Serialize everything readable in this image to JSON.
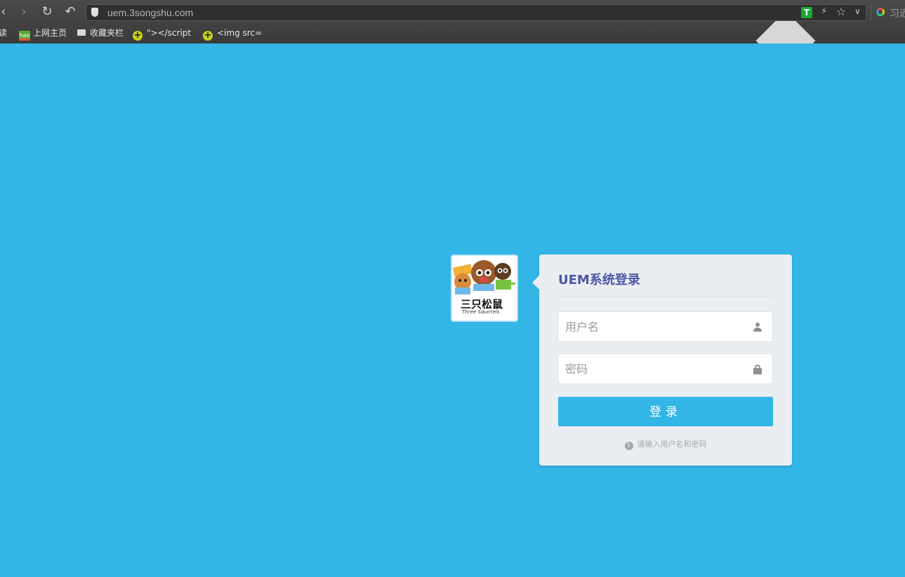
{
  "browser": {
    "url": "uem.3songshu.com",
    "search_label": "习近",
    "extension_t_label": "T",
    "bookmarks": [
      {
        "label": "读",
        "icon": "bookmark-fragment"
      },
      {
        "label": "上网主页",
        "icon": "hao-icon"
      },
      {
        "label": "收藏夹栏",
        "icon": "folder-icon"
      },
      {
        "label": "\"></script",
        "icon": "plus-icon"
      },
      {
        "label": "<img src=",
        "icon": "plus-icon"
      }
    ]
  },
  "login": {
    "logo": {
      "brand_cn": "三只松鼠",
      "brand_en": "Three Squirrels"
    },
    "title": "UEM系统登录",
    "username_placeholder": "用户名",
    "password_placeholder": "密码",
    "submit_label": "登录",
    "hint": "请输入用户名和密码"
  },
  "colors": {
    "page_background": "#33b5e5",
    "card_background": "#eaeef2",
    "title_color": "#4c58a6",
    "button_color": "#33b5e5"
  }
}
